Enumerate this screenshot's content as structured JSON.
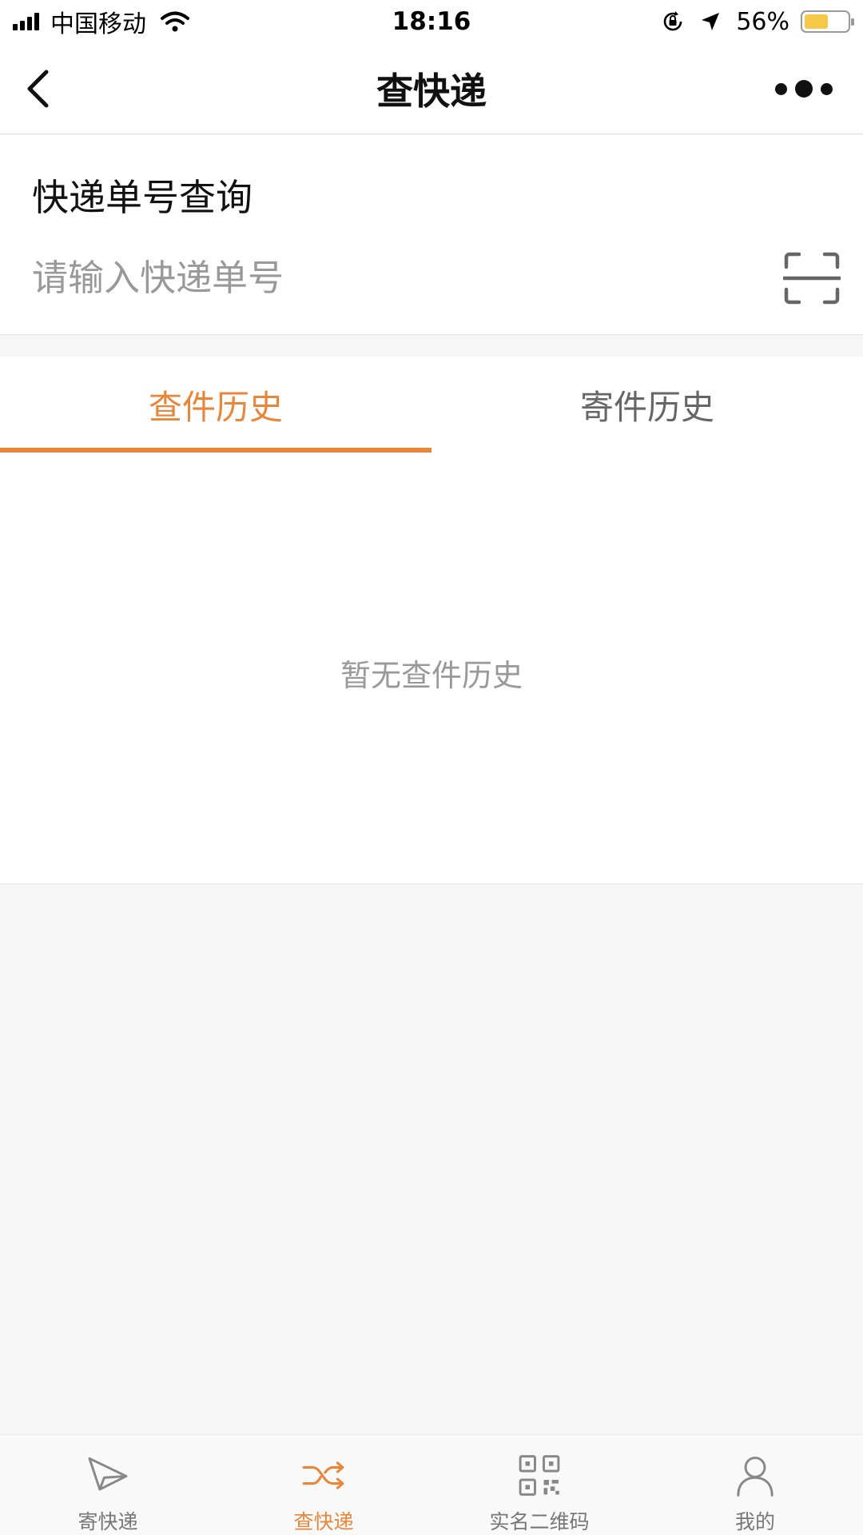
{
  "status_bar": {
    "carrier": "中国移动",
    "time": "18:16",
    "battery_percent": "56%",
    "battery_level": 0.56
  },
  "nav": {
    "title": "查快递",
    "back_icon": "chevron-left-icon",
    "more_icon": "more-dots-icon"
  },
  "search": {
    "heading": "快递单号查询",
    "placeholder": "请输入快递单号",
    "value": "",
    "scan_icon": "scan-icon"
  },
  "tabs": [
    {
      "label": "查件历史",
      "active": true
    },
    {
      "label": "寄件历史",
      "active": false
    }
  ],
  "content": {
    "empty_text": "暂无查件历史"
  },
  "bottom_nav": [
    {
      "label": "寄快递",
      "icon": "paper-plane-icon",
      "active": false
    },
    {
      "label": "查快递",
      "icon": "shuffle-icon",
      "active": true
    },
    {
      "label": "实名二维码",
      "icon": "qr-code-icon",
      "active": false
    },
    {
      "label": "我的",
      "icon": "user-icon",
      "active": false
    }
  ],
  "colors": {
    "accent": "#e8863a",
    "battery": "#f6c84a"
  }
}
